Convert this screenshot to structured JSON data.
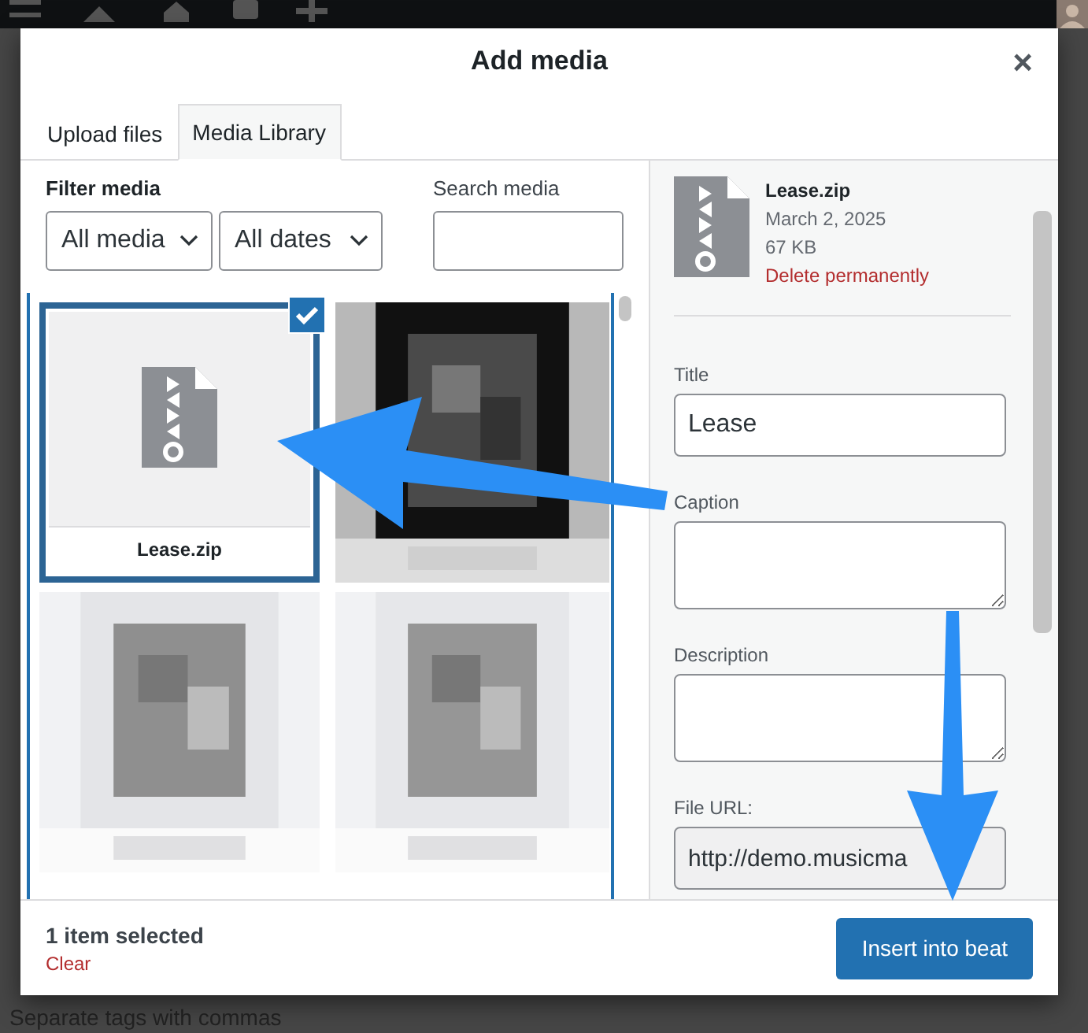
{
  "background": {
    "hint": "Separate tags with commas"
  },
  "modal": {
    "title": "Add media",
    "close": "×"
  },
  "tabs": [
    {
      "label": "Upload files",
      "selected": false
    },
    {
      "label": "Media Library",
      "selected": true
    }
  ],
  "filter": {
    "label": "Filter media",
    "type_select": "All media",
    "date_select": "All dates"
  },
  "search": {
    "label": "Search media"
  },
  "attachments": [
    {
      "kind": "file",
      "filename": "Lease.zip",
      "selected": true
    },
    {
      "kind": "picture",
      "selected": false
    },
    {
      "kind": "picture",
      "selected": false
    },
    {
      "kind": "picture",
      "selected": false
    }
  ],
  "details": {
    "filename": "Lease.zip",
    "date": "March 2, 2025",
    "size": "67 KB",
    "delete_link": "Delete permanently",
    "fields": [
      {
        "label": "Title",
        "kind": "input",
        "value": "Lease"
      },
      {
        "label": "Caption",
        "kind": "textarea"
      },
      {
        "label": "Description",
        "kind": "textarea"
      },
      {
        "label": "File URL:",
        "kind": "readonly",
        "value": "http://demo.musicma"
      }
    ]
  },
  "footer": {
    "count": "1 item selected",
    "clear": "Clear",
    "button": "Insert into beat"
  }
}
